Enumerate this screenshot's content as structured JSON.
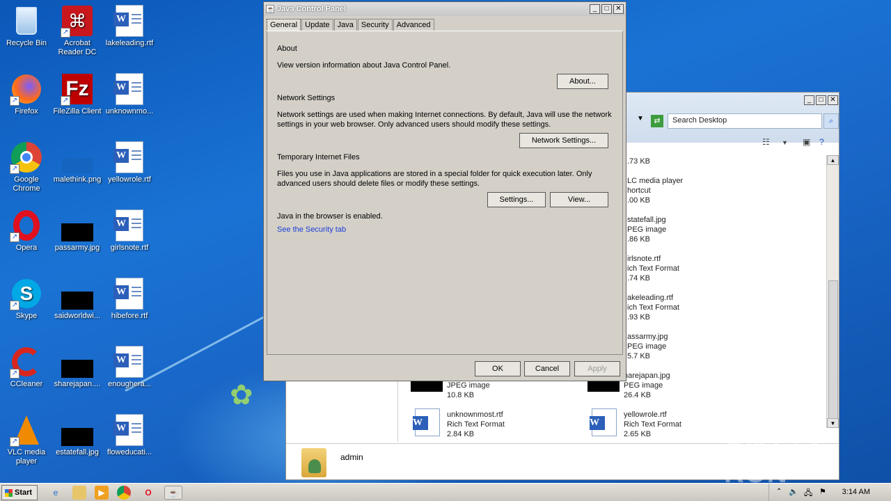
{
  "desktop": {
    "icons": [
      {
        "label": "Recycle Bin",
        "icon": "recycle-bin-icon"
      },
      {
        "label": "Acrobat Reader DC",
        "icon": "acrobat-icon"
      },
      {
        "label": "lakeleading.rtf",
        "icon": "word-doc-icon"
      },
      {
        "label": "Firefox",
        "icon": "firefox-icon"
      },
      {
        "label": "FileZilla Client",
        "icon": "filezilla-icon"
      },
      {
        "label": "unknownmo...",
        "icon": "word-doc-icon"
      },
      {
        "label": "Google Chrome",
        "icon": "chrome-icon"
      },
      {
        "label": "malethink.png",
        "icon": "image-icon"
      },
      {
        "label": "yellowrole.rtf",
        "icon": "word-doc-icon"
      },
      {
        "label": "Opera",
        "icon": "opera-icon"
      },
      {
        "label": "passarmy.jpg",
        "icon": "image-icon"
      },
      {
        "label": "girlsnote.rtf",
        "icon": "word-doc-icon"
      },
      {
        "label": "Skype",
        "icon": "skype-icon"
      },
      {
        "label": "saidworldwi...",
        "icon": "image-icon"
      },
      {
        "label": "hibefore.rtf",
        "icon": "word-doc-icon"
      },
      {
        "label": "CCleaner",
        "icon": "ccleaner-icon"
      },
      {
        "label": "sharejapan....",
        "icon": "image-icon"
      },
      {
        "label": "enoughera...",
        "icon": "word-doc-icon"
      },
      {
        "label": "VLC media player",
        "icon": "vlc-icon"
      },
      {
        "label": "estatefall.jpg",
        "icon": "image-icon"
      },
      {
        "label": "floweducati...",
        "icon": "word-doc-icon"
      }
    ]
  },
  "explorer": {
    "search_placeholder": "Search Desktop",
    "files": [
      {
        "line1": ".73 KB"
      },
      {
        "line1": "LC media player",
        "line2": "hortcut",
        "line3": ".00 KB"
      },
      {
        "line1": "statefall.jpg",
        "line2": "PEG image",
        "line3": ".86 KB"
      },
      {
        "line1": "irlsnote.rtf",
        "line2": "ich Text Format",
        "line3": ".74 KB"
      },
      {
        "line1": "akeleading.rtf",
        "line2": "ich Text Format",
        "line3": ".93 KB"
      },
      {
        "line1": "assarmy.jpg",
        "line2": "PEG image",
        "line3": "5.7 KB"
      },
      {
        "line1": "harejapan.jpg",
        "line2": "PEG image",
        "line3": "26.4 KB"
      },
      {
        "line1": "yellowrole.rtf",
        "line2": "Rich Text Format",
        "line3": "2.65 KB"
      }
    ],
    "left_files": [
      {
        "line2": "JPEG image",
        "line3": "10.8 KB"
      },
      {
        "line1": "unknownmost.rtf",
        "line2": "Rich Text Format",
        "line3": "2.84 KB"
      }
    ],
    "user_label": "admin"
  },
  "java": {
    "title": "Java Control Panel",
    "tabs": [
      "General",
      "Update",
      "Java",
      "Security",
      "Advanced"
    ],
    "about_heading": "About",
    "about_text": "View version information about Java Control Panel.",
    "about_button": "About...",
    "network_heading": "Network Settings",
    "network_text1": "Network settings are used when making Internet connections. By default, Java will use the network",
    "network_text2": "settings in your web browser. Only advanced users should modify these settings.",
    "network_button": "Network Settings...",
    "temp_heading": "Temporary Internet Files",
    "temp_text1": "Files you use in Java applications are stored in a special folder for quick execution later. Only",
    "temp_text2": "advanced users should delete files or modify these settings.",
    "settings_button": "Settings...",
    "view_button": "View...",
    "browser_status": "Java in the browser is enabled.",
    "security_link": "See the Security tab",
    "ok": "OK",
    "cancel": "Cancel",
    "apply": "Apply"
  },
  "taskbar": {
    "start": "Start",
    "clock": "3:14 AM"
  },
  "watermark": "ANY RUN"
}
